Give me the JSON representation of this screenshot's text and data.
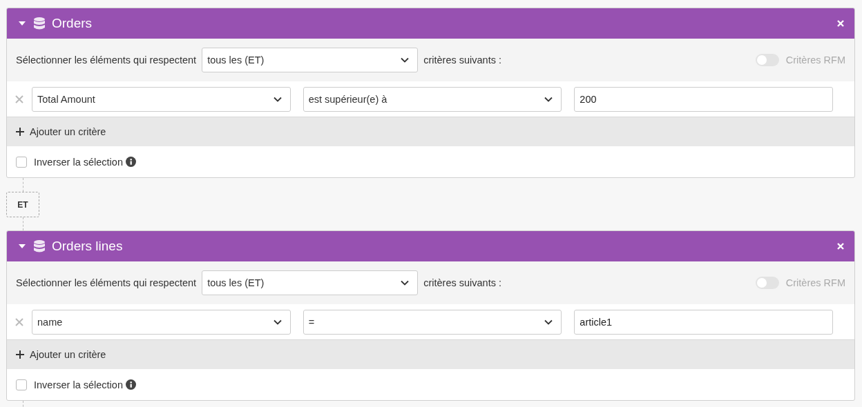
{
  "blocks": [
    {
      "title": "Orders",
      "expanded": true,
      "match_prefix": "Sélectionner les éléments qui respectent",
      "match_value": "tous les (ET)",
      "match_suffix": "critères suivants :",
      "rfm": {
        "label": "Critères RFM",
        "on": false
      },
      "criteria": [
        {
          "field": "Total Amount",
          "operator": "est supérieur(e) à",
          "value": "200"
        }
      ],
      "add_label": "Ajouter un critère",
      "invert": {
        "label": "Inverser la sélection",
        "checked": false
      }
    },
    {
      "title": "Orders lines",
      "expanded": true,
      "match_prefix": "Sélectionner les éléments qui respectent",
      "match_value": "tous les (ET)",
      "match_suffix": "critères suivants :",
      "rfm": {
        "label": "Critères RFM",
        "on": false
      },
      "criteria": [
        {
          "field": "name",
          "operator": "=",
          "value": "article1"
        }
      ],
      "add_label": "Ajouter un critère",
      "invert": {
        "label": "Inverser la sélection",
        "checked": false
      }
    }
  ],
  "connectors": [
    "ET"
  ]
}
